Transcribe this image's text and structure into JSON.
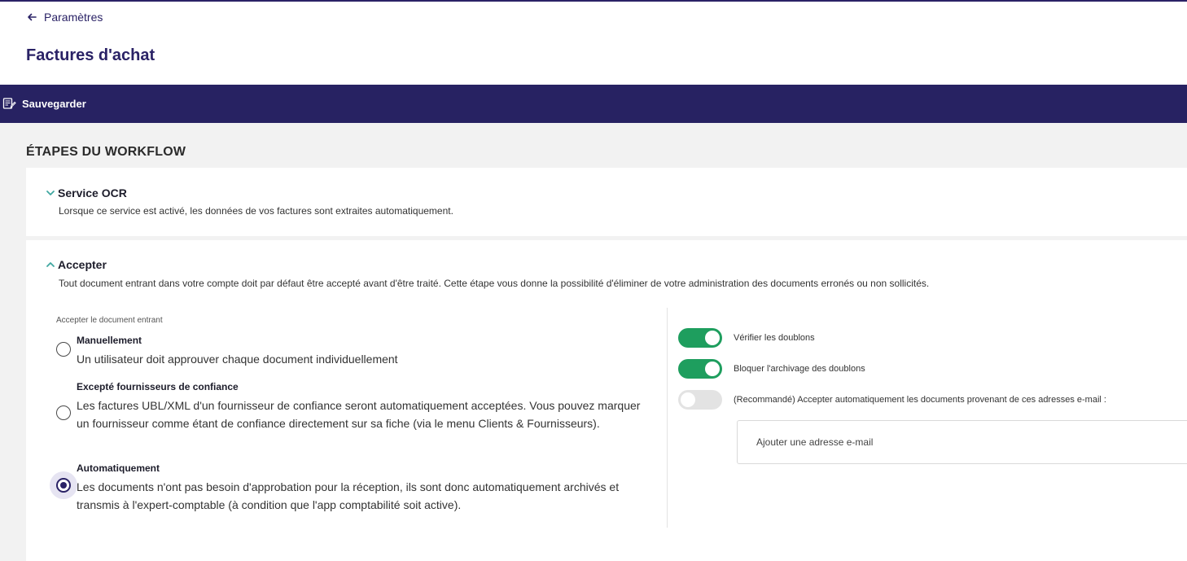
{
  "nav": {
    "back_label": "Paramètres"
  },
  "page": {
    "title": "Factures d'achat"
  },
  "toolbar": {
    "save_label": "Sauvegarder"
  },
  "workflow": {
    "section_title": "ÉTAPES DU WORKFLOW",
    "ocr": {
      "title": "Service OCR",
      "description": "Lorsque ce service est activé, les données de vos factures sont extraites automatiquement.",
      "expanded": false
    },
    "accept": {
      "title": "Accepter",
      "description": "Tout document entrant dans votre compte doit par défaut être accepté avant d'être traité. Cette étape vous donne la possibilité d'éliminer de votre administration des documents erronés ou non sollicités.",
      "expanded": true,
      "group_label": "Accepter le document entrant",
      "options": [
        {
          "title": "Manuellement",
          "text": "Un utilisateur doit approuver chaque document individuellement",
          "selected": false
        },
        {
          "title": "Excepté fournisseurs de confiance",
          "text": "Les factures UBL/XML d'un fournisseur de confiance seront automatiquement acceptées. Vous pouvez marquer un fournisseur comme étant de confiance directement sur sa fiche (via le menu Clients & Fournisseurs).",
          "selected": false
        },
        {
          "title": "Automatiquement",
          "text": "Les documents n'ont pas besoin d'approbation pour la réception, ils sont donc automatiquement archivés et transmis à l'expert-comptable (à condition que l'app comptabilité soit active).",
          "selected": true
        }
      ],
      "toggles": [
        {
          "label": "Vérifier les doublons",
          "on": true
        },
        {
          "label": "Bloquer l'archivage des doublons",
          "on": true
        },
        {
          "label": "(Recommandé) Accepter automatiquement les documents provenant de ces adresses e-mail :",
          "on": false
        }
      ],
      "email_placeholder": "Ajouter une adresse e-mail"
    }
  },
  "colors": {
    "brand": "#272262",
    "toggle_on": "#1e9e5e",
    "toggle_off": "#e3e3e3",
    "chevron": "#3fa7a0"
  }
}
